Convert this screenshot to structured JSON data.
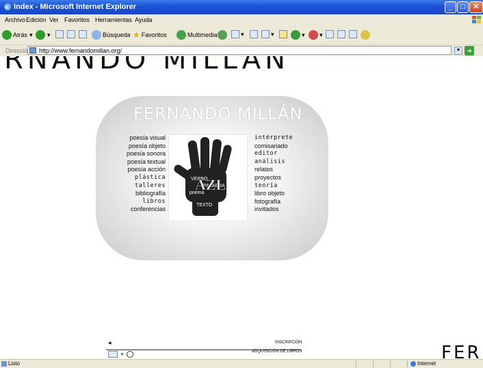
{
  "window": {
    "title": "Index - Microsoft Internet Explorer"
  },
  "menu": [
    "Archivo",
    "Edición",
    "Ver",
    "Favoritos",
    "Herramientas",
    "Ayuda"
  ],
  "toolbar": {
    "back": "Atrás",
    "search": "Búsqueda",
    "favorites": "Favoritos",
    "multimedia": "Multimedia"
  },
  "address": {
    "label": "Dirección",
    "url": "http://www.fernandomillan.org/"
  },
  "page": {
    "banner": "RNANDO MILLAN",
    "title": "FERNANDO MILLÁN",
    "left_links": [
      "poesía visual",
      "poesía objeto",
      "poesía sonora",
      "poesía textual",
      "poesía acción",
      "plástica",
      "talleres",
      "bibliografía",
      "libros",
      "conferencias"
    ],
    "right_links": [
      "intérprete",
      "comisariado",
      "editor",
      "análisis",
      "relatos",
      "proyectos",
      "teoría",
      "libro objeto",
      "fotografía",
      "invitados"
    ],
    "inscription": "INSCRIPCIÓN",
    "acquisition": "ADQUISICIÓN DE LIBROS",
    "corner_text": "FER"
  },
  "status": {
    "text": "Listo",
    "zone": "Internet"
  },
  "colors": {
    "titlebar": "#1b52d6",
    "chrome": "#ece9d8"
  }
}
